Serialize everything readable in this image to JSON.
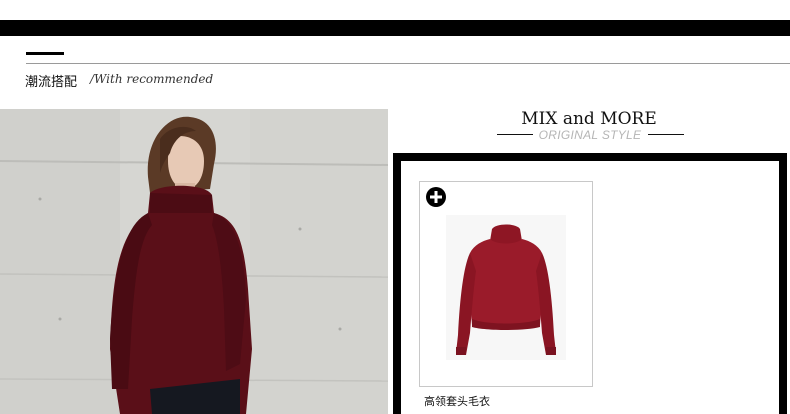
{
  "section": {
    "title": "潮流搭配",
    "subtitle": "/With recommended"
  },
  "promo": {
    "title": "MIX and MORE",
    "subtitle": "ORIGINAL STYLE"
  },
  "product": {
    "name": "高领套头毛衣",
    "color": "#9a1b2a",
    "add_icon": "plus-circle-icon"
  },
  "photo": {
    "garment_color": "#5a0f18"
  },
  "colors": {
    "bar": "#000000",
    "rule": "#9a9a9a",
    "subtitle_gray": "#b5b5b5"
  }
}
